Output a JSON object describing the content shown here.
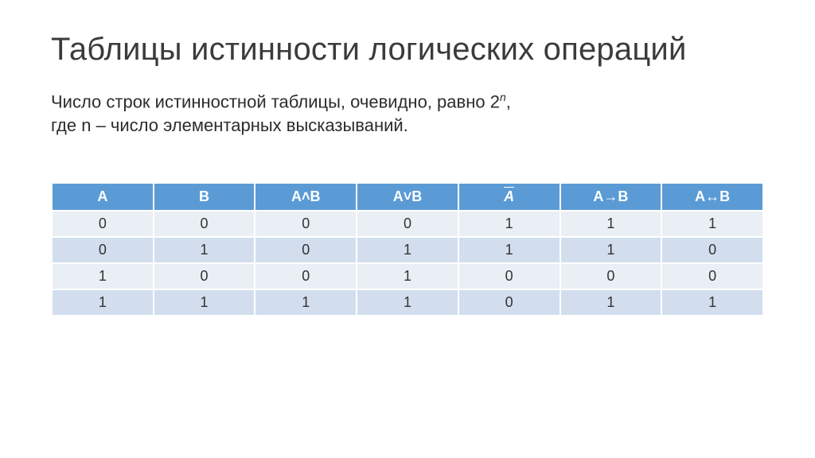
{
  "title": "Таблицы истинности логических операций",
  "body_line1_prefix": "Число строк истинностной таблицы, очевидно, равно ",
  "body_line1_base": "2",
  "body_line1_exp": "n",
  "body_line1_suffix": ",",
  "body_line2": "где n – число элементарных высказываний.",
  "table": {
    "headers": {
      "a": "A",
      "b": "B",
      "and": "A˄B",
      "or": "A˅B",
      "not_a_char": "A",
      "impl": "A→B",
      "equiv": "A↔B"
    },
    "rows": [
      {
        "a": "0",
        "b": "0",
        "and": "0",
        "or": "0",
        "not": "1",
        "impl": "1",
        "equiv": "1"
      },
      {
        "a": "0",
        "b": "1",
        "and": "0",
        "or": "1",
        "not": "1",
        "impl": "1",
        "equiv": "0"
      },
      {
        "a": "1",
        "b": "0",
        "and": "0",
        "or": "1",
        "not": "0",
        "impl": "0",
        "equiv": "0"
      },
      {
        "a": "1",
        "b": "1",
        "and": "1",
        "or": "1",
        "not": "0",
        "impl": "1",
        "equiv": "1"
      }
    ]
  }
}
